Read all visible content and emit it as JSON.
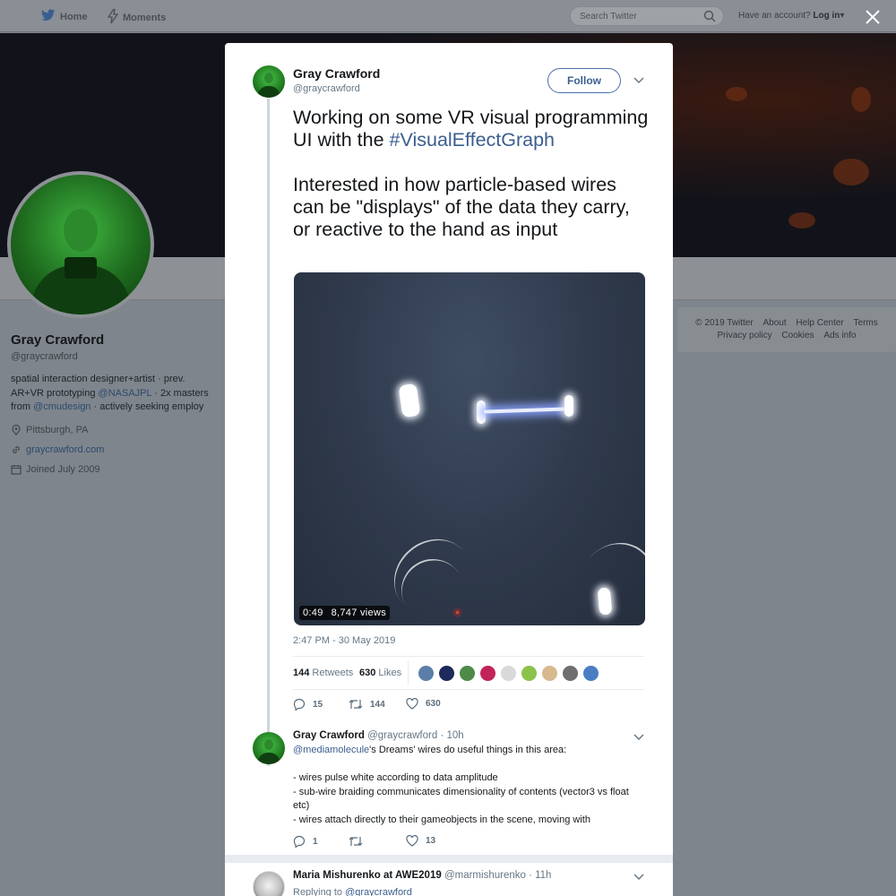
{
  "nav": {
    "home_label": "Home",
    "moments_label": "Moments",
    "search_placeholder": "Search Twitter",
    "have_account": "Have an account?",
    "login_label": "Log in"
  },
  "profile": {
    "name": "Gray Crawford",
    "handle": "@graycrawford",
    "bio": {
      "part1": "spatial interaction designer+artist · prev. AR+VR prototyping ",
      "link1": "@NASAJPL",
      "part2": " · 2x masters from ",
      "link2": "@cmudesign",
      "part3": " · actively seeking employ"
    },
    "location": "Pittsburgh, PA",
    "website": "graycrawford.com",
    "joined": "Joined July 2009"
  },
  "footer": {
    "items_row1": [
      "© 2019 Twitter",
      "About",
      "Help Center",
      "Terms"
    ],
    "items_row2": [
      "Privacy policy",
      "Cookies",
      "Ads info"
    ]
  },
  "tweet": {
    "author_name": "Gray Crawford",
    "author_handle": "@graycrawford",
    "follow_label": "Follow",
    "text_line1": "Working on some VR visual programming UI with the ",
    "hashtag": "#VisualEffectGraph",
    "text_para2": "Interested in how particle-based wires can be \"displays\" of the data they carry, or reactive to the hand as input",
    "video_duration": "0:49",
    "video_views": "8,747 views",
    "timestamp": "2:47 PM - 30 May 2019",
    "retweets_count": "144",
    "retweets_label": "Retweets",
    "likes_count": "630",
    "likes_label": "Likes",
    "likers_colors": [
      "#5b7fa8",
      "#1d2a5a",
      "#4e8a4a",
      "#c2245a",
      "#d9d9d9",
      "#8bc34a",
      "#d7b98e",
      "#6f6f6f",
      "#4a7ec4"
    ],
    "actions": {
      "replies": "15",
      "retweets": "144",
      "likes": "630"
    }
  },
  "reply1": {
    "name": "Gray Crawford",
    "handle": "@graycrawford",
    "time": "· 10h",
    "mention": "@mediamolecule",
    "line1": "'s Dreams' wires do useful things in this area:",
    "line2": "- wires pulse white according to data amplitude",
    "line3": "- sub-wire braiding communicates dimensionality of contents (vector3 vs float etc)",
    "line4": "- wires attach directly to their gameobjects in the scene, moving with",
    "actions": {
      "replies": "1",
      "retweets": "",
      "likes": "13"
    }
  },
  "reply2": {
    "name": "Maria Mishurenko at AWE2019",
    "handle": "@marmishurenko",
    "time": "· 11h",
    "replying_prefix": "Replying to ",
    "replying_to": "@graycrawford"
  }
}
